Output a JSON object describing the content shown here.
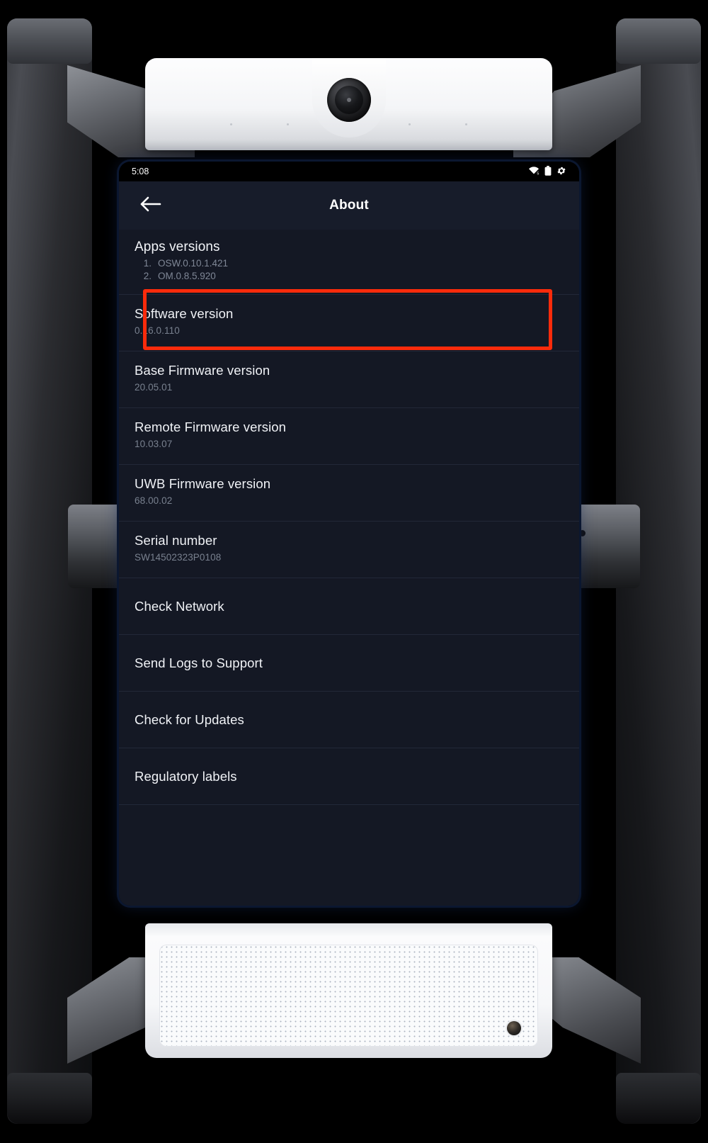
{
  "device": {
    "camera": {
      "lens_icon": "camera-lens",
      "mic_icon": "microphone-pinhole"
    },
    "speaker": {
      "grille_icon": "speaker-grille",
      "port_icon": "audio-port"
    },
    "mount": {
      "post_icon": "stand-post",
      "arm_icon": "mount-arm",
      "joint_icon": "pivot-knuckle"
    }
  },
  "statusbar": {
    "time": "5:08",
    "icons": [
      "wifi-5-icon",
      "battery-icon",
      "gear-icon"
    ]
  },
  "appbar": {
    "back_icon": "back-arrow-icon",
    "title": "About"
  },
  "apps_versions": {
    "title": "Apps versions",
    "items": [
      {
        "index": "1.",
        "value": "OSW.0.10.1.421"
      },
      {
        "index": "2.",
        "value": "OM.0.8.5.920"
      }
    ]
  },
  "info_rows": [
    {
      "label": "Software version",
      "value": "0.16.0.110",
      "highlighted": true
    },
    {
      "label": "Base Firmware version",
      "value": "20.05.01",
      "highlighted": false
    },
    {
      "label": "Remote Firmware version",
      "value": "10.03.07",
      "highlighted": false
    },
    {
      "label": "UWB Firmware version",
      "value": "68.00.02",
      "highlighted": false
    },
    {
      "label": "Serial number",
      "value": "SW14502323P0108",
      "highlighted": false
    }
  ],
  "action_rows": [
    {
      "label": "Check Network"
    },
    {
      "label": "Send Logs to Support"
    },
    {
      "label": "Check for Updates"
    },
    {
      "label": "Regulatory labels"
    }
  ],
  "annotation": {
    "target": "Software version",
    "color": "#fb2b0b"
  }
}
